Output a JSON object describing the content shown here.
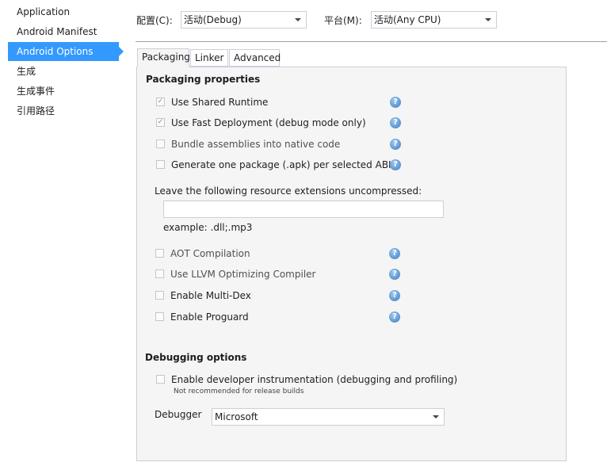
{
  "sidebar": {
    "items": [
      {
        "label": "Application",
        "active": false
      },
      {
        "label": "Android Manifest",
        "active": false
      },
      {
        "label": "Android Options",
        "active": true
      },
      {
        "label": "生成",
        "active": false
      },
      {
        "label": "生成事件",
        "active": false
      },
      {
        "label": "引用路径",
        "active": false
      }
    ]
  },
  "config": {
    "configuration_label": "配置(C):",
    "configuration_value": "活动(Debug)",
    "platform_label": "平台(M):",
    "platform_value": "活动(Any CPU)"
  },
  "tabs": [
    {
      "label": "Packaging",
      "active": true
    },
    {
      "label": "Linker",
      "active": false
    },
    {
      "label": "Advanced",
      "active": false
    }
  ],
  "packaging": {
    "title": "Packaging properties",
    "options": [
      {
        "label": "Use Shared Runtime",
        "checked": true
      },
      {
        "label": "Use Fast Deployment (debug mode only)",
        "checked": true
      },
      {
        "label": "Bundle assemblies into native code",
        "checked": false
      },
      {
        "label": "Generate one package (.apk) per selected ABI",
        "checked": false
      }
    ],
    "uncompressed_label": "Leave the following resource extensions uncompressed:",
    "uncompressed_value": "",
    "uncompressed_example": "example: .dll;.mp3",
    "advanced_options": [
      {
        "label": "AOT Compilation",
        "checked": false
      },
      {
        "label": "Use LLVM Optimizing Compiler",
        "checked": false
      },
      {
        "label": "Enable Multi-Dex",
        "checked": false
      },
      {
        "label": "Enable Proguard",
        "checked": false
      }
    ]
  },
  "debugging": {
    "title": "Debugging options",
    "instrumentation_label": "Enable developer instrumentation (debugging and profiling)",
    "instrumentation_checked": false,
    "instrumentation_note": "Not recommended for release builds",
    "debugger_label": "Debugger",
    "debugger_value": "Microsoft"
  },
  "icons": {
    "help": "question-mark-help-icon",
    "check": "✓",
    "help_glyph": "?"
  },
  "colors": {
    "accent": "#3399ff",
    "panel_bg": "#f5f5f5",
    "help_icon": "#3b7dc4"
  }
}
